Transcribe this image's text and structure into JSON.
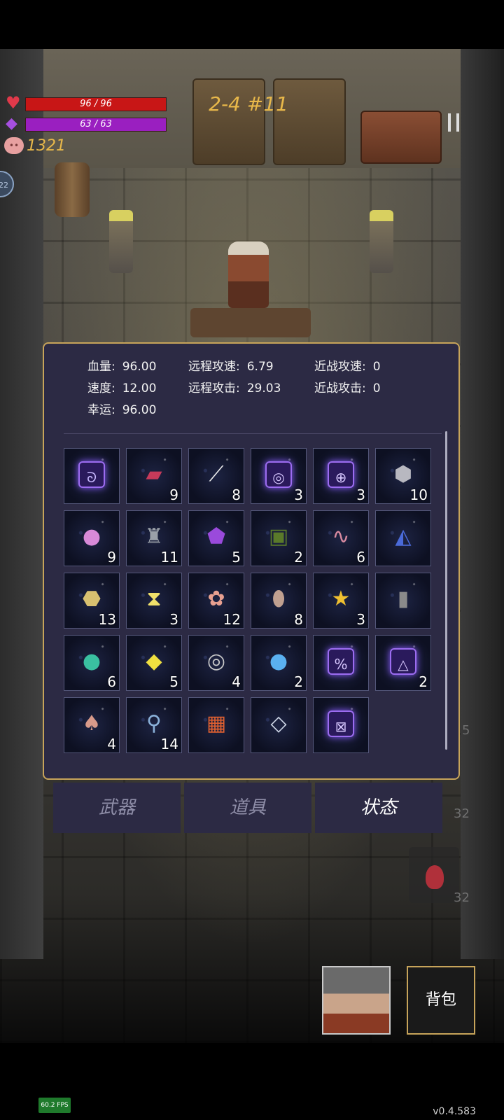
{
  "hud": {
    "hp": "96 / 96",
    "mp": "63 / 63",
    "coins": "1321",
    "level": "2-4 #11",
    "side_badge": "22"
  },
  "stats": {
    "col1": [
      {
        "label": "血量:",
        "value": "96.00"
      },
      {
        "label": "速度:",
        "value": "12.00"
      },
      {
        "label": "幸运:",
        "value": "96.00"
      }
    ],
    "col2": [
      {
        "label": "远程攻速:",
        "value": "6.79"
      },
      {
        "label": "远程攻击:",
        "value": "29.03"
      }
    ],
    "col3": [
      {
        "label": "近战攻速:",
        "value": "0"
      },
      {
        "label": "近战攻击:",
        "value": "0"
      }
    ]
  },
  "items": [
    {
      "icon": "rune-hook-icon",
      "count": ""
    },
    {
      "icon": "red-book-icon",
      "count": "9"
    },
    {
      "icon": "feather-icon",
      "count": "8"
    },
    {
      "icon": "rune-spiral-icon",
      "count": "3"
    },
    {
      "icon": "rune-cross-icon",
      "count": "3"
    },
    {
      "icon": "crystal-rock-icon",
      "count": "10"
    },
    {
      "icon": "pink-slime-icon",
      "count": "9"
    },
    {
      "icon": "hooded-statue-icon",
      "count": "11"
    },
    {
      "icon": "purple-shell-icon",
      "count": "5"
    },
    {
      "icon": "skull-book-icon",
      "count": "2"
    },
    {
      "icon": "worm-icon",
      "count": "6"
    },
    {
      "icon": "blue-spellbook-icon",
      "count": ""
    },
    {
      "icon": "ore-chunks-icon",
      "count": "13"
    },
    {
      "icon": "hourglass-card-icon",
      "count": "3"
    },
    {
      "icon": "flower-wreath-icon",
      "count": "12"
    },
    {
      "icon": "sack-icon",
      "count": "8"
    },
    {
      "icon": "star-trophy-icon",
      "count": "3"
    },
    {
      "icon": "gravestone-icon",
      "count": ""
    },
    {
      "icon": "rainbow-orb-icon",
      "count": "6"
    },
    {
      "icon": "yellow-crystal-icon",
      "count": "5"
    },
    {
      "icon": "silver-rings-icon",
      "count": "4"
    },
    {
      "icon": "blue-orb-icon",
      "count": "2"
    },
    {
      "icon": "rune-percent-icon",
      "count": ""
    },
    {
      "icon": "rune-triangle-icon",
      "count": "2"
    },
    {
      "icon": "mushroom-icon",
      "count": "4"
    },
    {
      "icon": "blue-key-icon",
      "count": "14"
    },
    {
      "icon": "fire-book-icon",
      "count": ""
    },
    {
      "icon": "diamond-box-icon",
      "count": ""
    },
    {
      "icon": "rune-x-icon",
      "count": ""
    }
  ],
  "tabs": [
    "武器",
    "道具",
    "状态"
  ],
  "active_tab": "状态",
  "ghost_numbers": [
    "5",
    "32",
    "32"
  ],
  "bag_label": "背包",
  "fps": "60.2 FPS",
  "version": "v0.4.583"
}
